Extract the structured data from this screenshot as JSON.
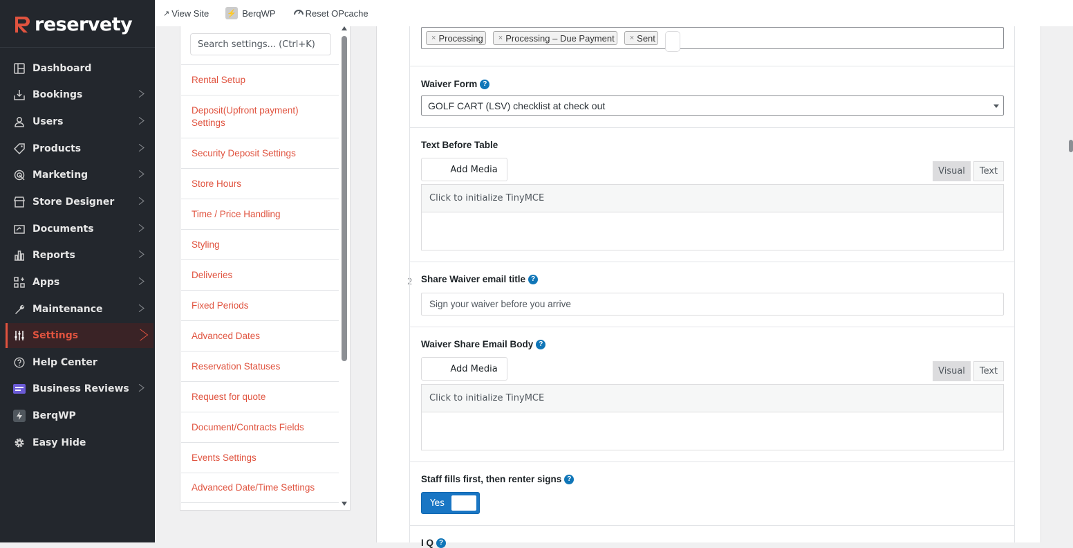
{
  "brand": {
    "name": "reservety",
    "accent": "#e0533f"
  },
  "sidebar": {
    "items": [
      {
        "label": "Dashboard",
        "icon": "dashboard-icon"
      },
      {
        "label": "Bookings",
        "icon": "bookings-icon"
      },
      {
        "label": "Users",
        "icon": "user-icon"
      },
      {
        "label": "Products",
        "icon": "tag-icon"
      },
      {
        "label": "Marketing",
        "icon": "marketing-icon"
      },
      {
        "label": "Store Designer",
        "icon": "store-icon"
      },
      {
        "label": "Documents",
        "icon": "documents-icon"
      },
      {
        "label": "Reports",
        "icon": "chart-icon"
      },
      {
        "label": "Apps",
        "icon": "apps-icon"
      },
      {
        "label": "Maintenance",
        "icon": "wrench-icon"
      },
      {
        "label": "Settings",
        "icon": "sliders-icon"
      },
      {
        "label": "Help Center",
        "icon": "help-icon"
      },
      {
        "label": "Business Reviews",
        "icon": "reviews-icon"
      },
      {
        "label": "BerqWP",
        "icon": "berqwp-icon"
      },
      {
        "label": "Easy Hide",
        "icon": "gear-icon"
      }
    ],
    "active": "Settings"
  },
  "topbar": {
    "view_site": "View Site",
    "berqwp": "BerqWP",
    "reset_opcache": "Reset OPcache"
  },
  "settings_nav": {
    "search_placeholder": "Search settings... (Ctrl+K)",
    "items": [
      "Rental Setup",
      "Deposit(Upfront payment) Settings",
      "Security Deposit Settings",
      "Store Hours",
      "Time / Price Handling",
      "Styling",
      "Deliveries",
      "Fixed Periods",
      "Advanced Dates",
      "Reservation Statuses",
      "Request for quote",
      "Document/Contracts Fields",
      "Events Settings",
      "Advanced Date/Time Settings"
    ]
  },
  "form": {
    "status_tags": [
      "Processing",
      "Processing – Due Payment",
      "Sent"
    ],
    "tag_remove": "×",
    "row_number": "2",
    "waiver_form": {
      "label": "Waiver Form",
      "value": "GOLF CART (LSV) checklist at check out"
    },
    "text_before_table": {
      "label": "Text Before Table",
      "add_media": "Add Media",
      "visual": "Visual",
      "text": "Text",
      "init": "Click to initialize TinyMCE"
    },
    "share_title": {
      "label": "Share Waiver email title",
      "placeholder": "Sign your waiver before you arrive"
    },
    "share_body": {
      "label": "Waiver Share Email Body",
      "add_media": "Add Media",
      "visual": "Visual",
      "text": "Text",
      "init": "Click to initialize TinyMCE"
    },
    "staff_fills": {
      "label": "Staff fills first, then renter signs",
      "toggle": "Yes"
    },
    "next_label_partial": "I  Q"
  }
}
